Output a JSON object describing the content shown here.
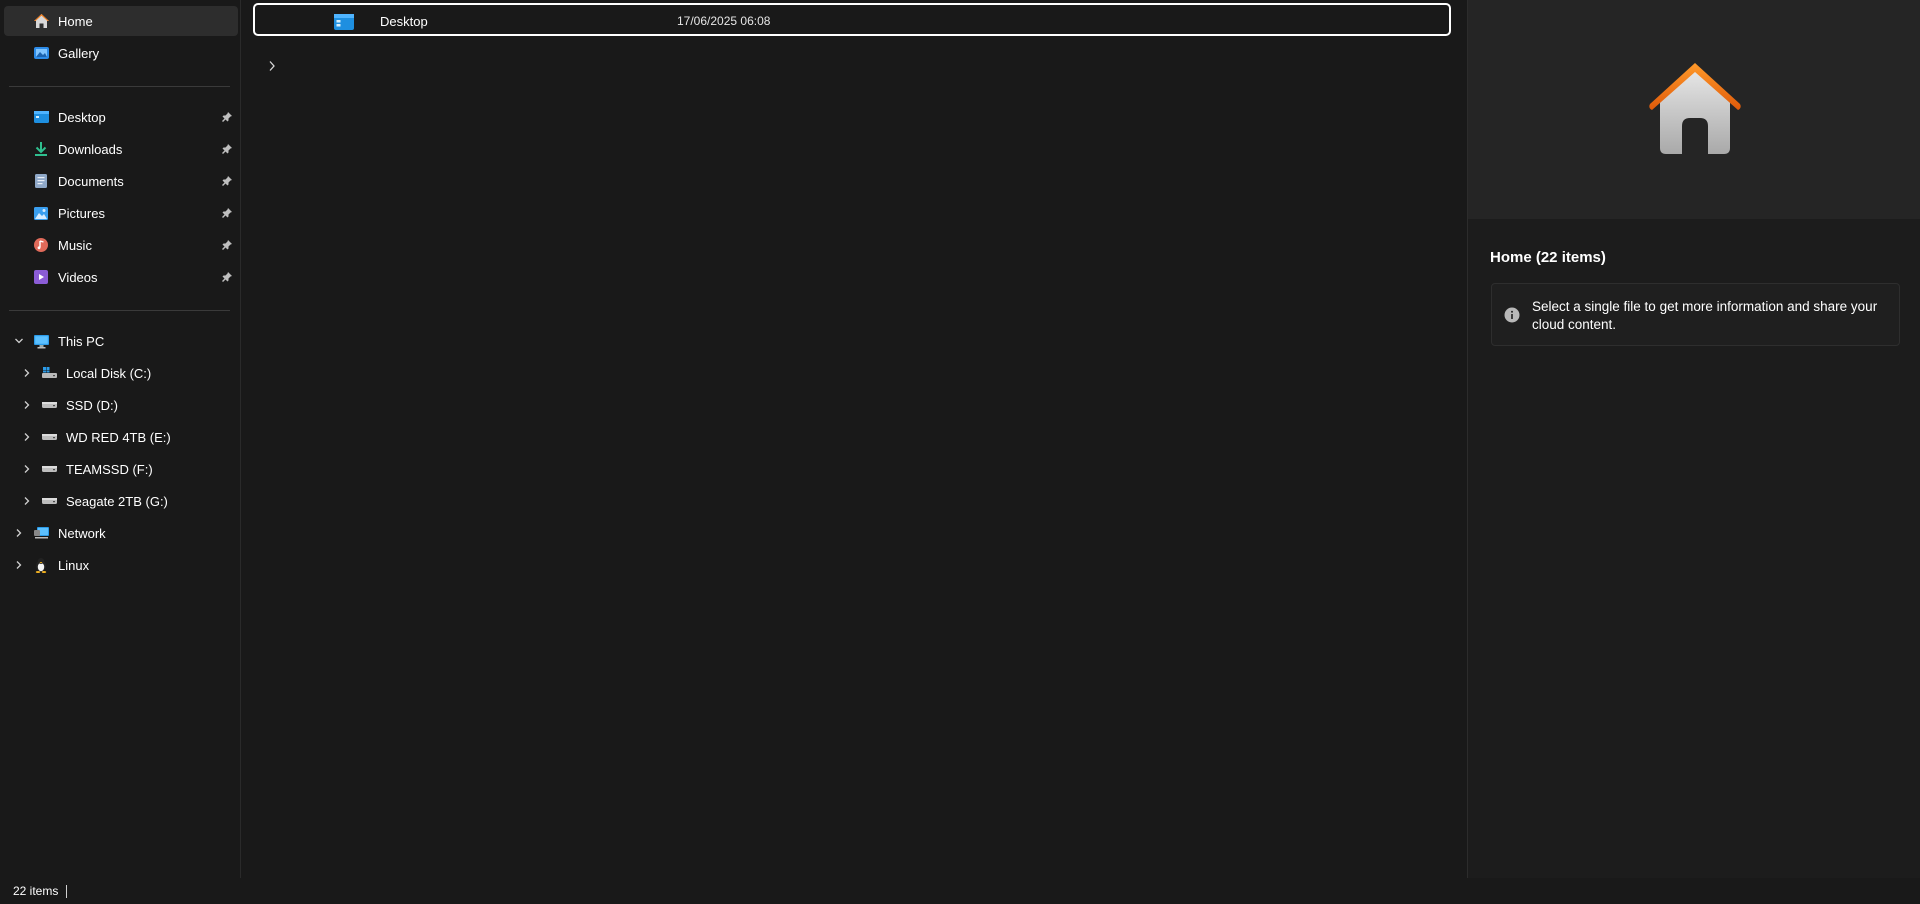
{
  "sidebar": {
    "home": "Home",
    "gallery": "Gallery",
    "pinned": [
      {
        "label": "Desktop",
        "icon": "desktop-folder-icon"
      },
      {
        "label": "Downloads",
        "icon": "downloads-icon"
      },
      {
        "label": "Documents",
        "icon": "documents-icon"
      },
      {
        "label": "Pictures",
        "icon": "pictures-icon"
      },
      {
        "label": "Music",
        "icon": "music-icon"
      },
      {
        "label": "Videos",
        "icon": "videos-icon"
      }
    ],
    "this_pc": "This PC",
    "drives": [
      {
        "label": "Local Disk (C:)"
      },
      {
        "label": "SSD (D:)"
      },
      {
        "label": "WD RED 4TB (E:)"
      },
      {
        "label": "TEAMSSD (F:)"
      },
      {
        "label": "Seagate 2TB (G:)"
      }
    ],
    "network": "Network",
    "linux": "Linux"
  },
  "main": {
    "row": {
      "name": "Desktop",
      "date": "17/06/2025 06:08"
    }
  },
  "details": {
    "title": "Home (22 items)",
    "message": "Select a single file to get more information and share your cloud content."
  },
  "status": {
    "count": "22 items"
  },
  "colors": {
    "background": "#191919",
    "selected": "#2d2d2d",
    "accent_orange": "#f07b1a"
  }
}
